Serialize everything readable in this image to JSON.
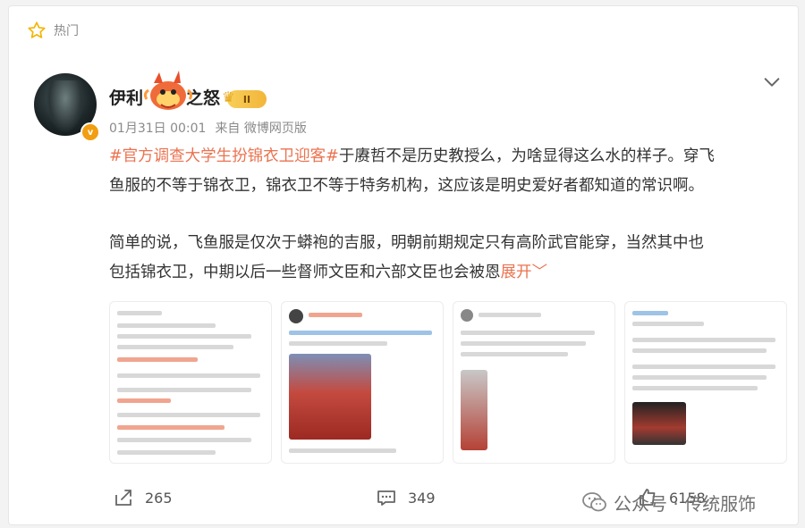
{
  "section": {
    "label": "热门"
  },
  "post": {
    "author": "伊利",
    "author_suffix": "之怒",
    "vip_level": "II",
    "date": "01月31日 00:01",
    "source": "来自 微博网页版",
    "topic": "#官方调查大学生扮锦衣卫迎客#",
    "text_line1_rest": "于赓哲不是历史教授么，为啥显得这么水的样子。穿飞",
    "text_line2": "鱼服的不等于锦衣卫，锦衣卫不等于特务机构，这应该是明史爱好者都知道的常识啊。",
    "text_line3": "简单的说，飞鱼服是仅次于蟒袍的吉服，明朝前期规定只有高阶武官能穿，当然其中也",
    "text_line4": "包括锦衣卫，中期以后一些督师文臣和六部文臣也会被恩",
    "expand_label": "展开"
  },
  "actions": {
    "repost_count": "265",
    "comment_count": "349",
    "like_count": "6158"
  },
  "watermark": {
    "text": "公众号 · 传统服饰"
  },
  "colors": {
    "accent": "#eb7350",
    "vip": "#f3b53a",
    "verified": "#f29d12"
  }
}
